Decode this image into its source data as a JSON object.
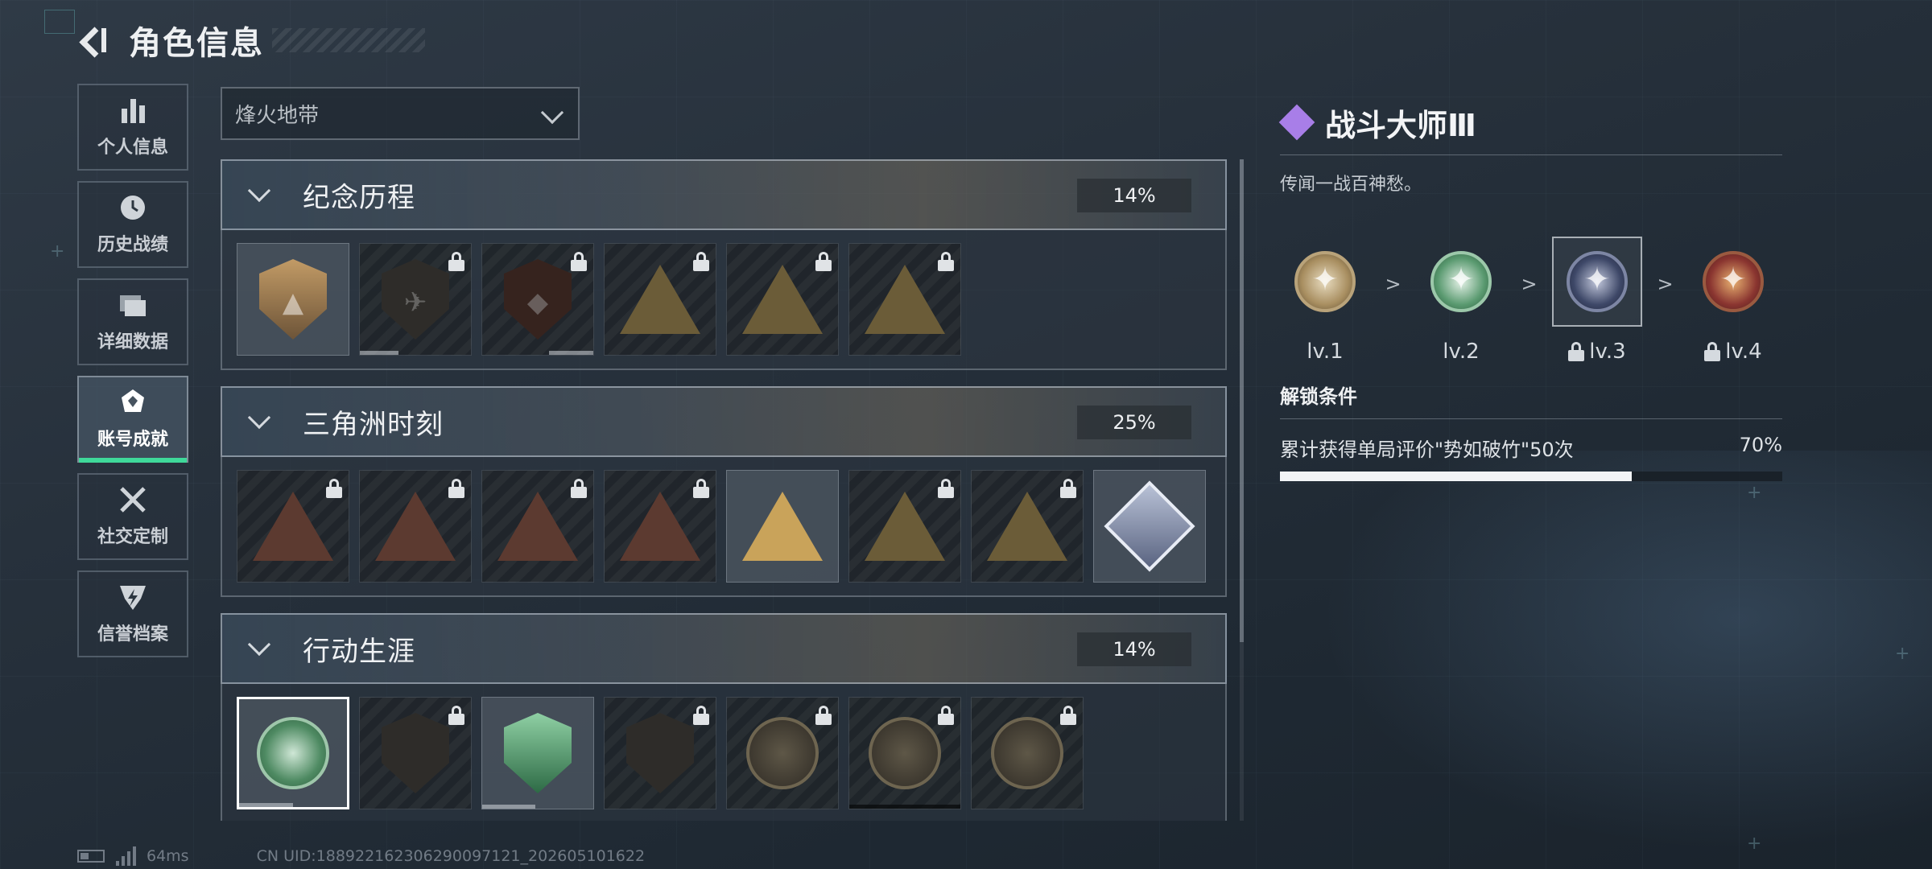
{
  "header": {
    "title": "角色信息"
  },
  "sidebar": {
    "items": [
      {
        "label": "个人信息",
        "icon": "bar-chart-icon"
      },
      {
        "label": "历史战绩",
        "icon": "clock-icon"
      },
      {
        "label": "详细数据",
        "icon": "folder-icon"
      },
      {
        "label": "账号成就",
        "icon": "achievement-icon",
        "active": true
      },
      {
        "label": "社交定制",
        "icon": "tools-icon"
      },
      {
        "label": "信誉档案",
        "icon": "shield-bolt-icon"
      }
    ]
  },
  "mode_select": {
    "value": "烽火地带"
  },
  "categories": [
    {
      "title": "纪念历程",
      "percent": "14%"
    },
    {
      "title": "三角洲时刻",
      "percent": "25%"
    },
    {
      "title": "行动生涯",
      "percent": "14%"
    }
  ],
  "detail": {
    "title": "战斗大师Ⅲ",
    "description": "传闻一战百神愁。",
    "levels": [
      {
        "label": "lv.1",
        "locked": false
      },
      {
        "label": "lv.2",
        "locked": false
      },
      {
        "label": "lv.3",
        "locked": true,
        "selected": true
      },
      {
        "label": "lv.4",
        "locked": true
      }
    ],
    "separator": ">",
    "unlock_title": "解锁条件",
    "condition": "累计获得单局评价\"势如破竹\"50次",
    "progress_text": "70%",
    "progress": 0.7
  },
  "footer": {
    "ping": "64ms",
    "uid": "CN UID:188922162306290097121_202605101622"
  },
  "colors": {
    "accent_green": "#3fd99a",
    "purple": "#a87ee8"
  }
}
